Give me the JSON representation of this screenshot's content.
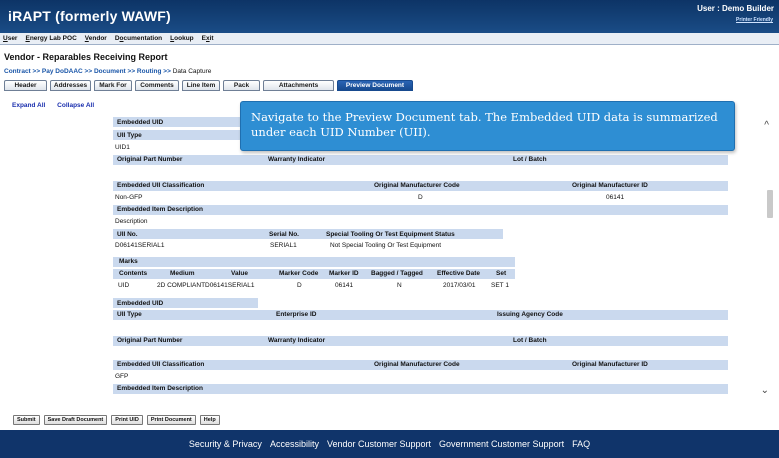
{
  "header": {
    "app_title": "iRAPT (formerly WAWF)",
    "user": "User : Demo Builder",
    "printer_friendly": "Printer Friendly"
  },
  "menu": [
    {
      "pre": "",
      "u": "U",
      "post": "ser"
    },
    {
      "pre": "",
      "u": "E",
      "post": "nergy Lab POC"
    },
    {
      "pre": "",
      "u": "V",
      "post": "endor"
    },
    {
      "pre": "D",
      "u": "o",
      "post": "cumentation"
    },
    {
      "pre": "",
      "u": "L",
      "post": "ookup"
    },
    {
      "pre": "E",
      "u": "x",
      "post": "it"
    }
  ],
  "doc_title": "Vendor - Reparables Receiving Report",
  "breadcrumb": {
    "links": "Contract >> Pay DoDAAC >> Document >> Routing >>",
    "current": "Data Capture"
  },
  "tabs": [
    "Header",
    "Addresses",
    "Mark For",
    "Comments",
    "Line Item",
    "Pack",
    "Attachments",
    "Preview Document"
  ],
  "active_tab": "Preview Document",
  "expand_all": "Expand All",
  "collapse_all": "Collapse All",
  "callout": "Navigate to the Preview Document tab.  The Embedded UID data is summarized under each UID Number (UII).",
  "uid1": {
    "embedded_uid": "Embedded UID",
    "uii_type": "UII Type",
    "uii_type_value": "UID1",
    "original_part_number": "Original Part Number",
    "warranty_indicator": "Warranty Indicator",
    "lot_batch": "Lot / Batch",
    "uii_classification": "Embedded UII Classification",
    "orig_mfr_code": "Original Manufacturer Code",
    "orig_mfr_id": "Original Manufacturer ID",
    "classification_value": "Non-GFP",
    "mfr_code_value": "D",
    "mfr_id_value": "06141",
    "item_description": "Embedded Item Description",
    "description_value": "Description",
    "uii_no": "UII No.",
    "serial_no": "Serial No.",
    "special_tooling": "Special Tooling Or Test Equipment Status",
    "uii_no_value": "D06141SERIAL1",
    "serial_value": "SERIAL1",
    "special_tooling_value": "Not Special Tooling Or Test Equipment"
  },
  "marks": {
    "title": "Marks",
    "headers": [
      "Contents",
      "Medium",
      "Value",
      "Marker Code",
      "Marker ID",
      "Bagged / Tagged",
      "Effective Date",
      "Set"
    ],
    "row": [
      "UID",
      "2D COMPLIANT",
      "D06141SERIAL1",
      "D",
      "06141",
      "N",
      "2017/03/01",
      "SET 1"
    ]
  },
  "uid2": {
    "embedded_uid": "Embedded UID",
    "uii_type": "UII Type",
    "enterprise_id": "Enterprise ID",
    "issuing_agency": "Issuing Agency Code",
    "original_part_number": "Original Part Number",
    "warranty_indicator": "Warranty Indicator",
    "lot_batch": "Lot / Batch",
    "uii_classification": "Embedded UII Classification",
    "orig_mfr_code": "Original Manufacturer Code",
    "orig_mfr_id": "Original Manufacturer ID",
    "classification_value": "GFP",
    "item_description": "Embedded Item Description"
  },
  "buttons": [
    "Submit",
    "Save Draft Document",
    "Print UID",
    "Print Document",
    "Help"
  ],
  "footer": [
    "Security & Privacy",
    "Accessibility",
    "Vendor Customer Support",
    "Government Customer Support",
    "FAQ"
  ]
}
